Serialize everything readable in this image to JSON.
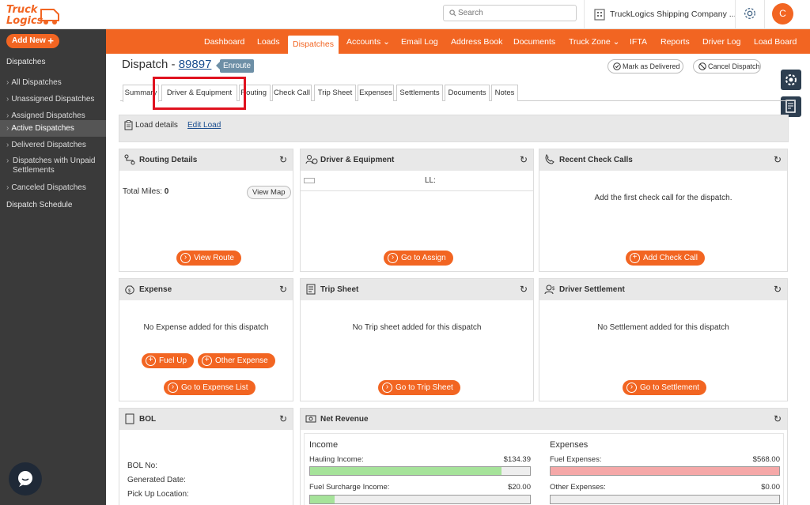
{
  "header": {
    "logo_text_line1": "Truck",
    "logo_text_line2": "Logics",
    "search_placeholder": "Search",
    "company_name": "TruckLogics Shipping Company ...",
    "avatar_initial": "C"
  },
  "sidebar": {
    "add_new": "Add New",
    "section": "Dispatches",
    "items": [
      {
        "label": "All Dispatches"
      },
      {
        "label": "Unassigned Dispatches"
      },
      {
        "label": "Assigned Dispatches"
      },
      {
        "label": "Active Dispatches"
      },
      {
        "label": "Delivered Dispatches"
      },
      {
        "label": "Dispatches with Unpaid Settlements"
      },
      {
        "label": "Canceled Dispatches"
      }
    ],
    "schedule": "Dispatch Schedule"
  },
  "nav": {
    "items": [
      "Dashboard",
      "Loads",
      "Dispatches",
      "Accounts",
      "Email Log",
      "Address Book",
      "Documents",
      "Truck Zone",
      "IFTA",
      "Reports",
      "Driver Log",
      "Load Board"
    ]
  },
  "dispatch": {
    "title_prefix": "Dispatch - ",
    "number": "89897",
    "status": "Enroute",
    "mark_delivered": "Mark as Delivered",
    "cancel_dispatch": "Cancel Dispatch"
  },
  "tabs": [
    "Summary",
    "Driver & Equipment",
    "Routing",
    "Check Call",
    "Trip Sheet",
    "Expenses",
    "Settlements",
    "Documents",
    "Notes"
  ],
  "load_details": {
    "label": "Load details",
    "edit": "Edit Load"
  },
  "panels": {
    "routing": {
      "title": "Routing Details",
      "miles_label": "Total Miles:",
      "miles_value": "0",
      "view_map": "View Map",
      "button": "View Route"
    },
    "driver": {
      "title": "Driver & Equipment",
      "ll": "LL:",
      "button": "Go to Assign"
    },
    "checkcalls": {
      "title": "Recent Check Calls",
      "message": "Add the first check call for the dispatch.",
      "button": "Add Check Call"
    },
    "expense": {
      "title": "Expense",
      "message": "No Expense added for this dispatch",
      "fuel": "Fuel Up",
      "other": "Other Expense",
      "list": "Go to Expense List"
    },
    "tripsheet": {
      "title": "Trip Sheet",
      "message": "No Trip sheet added for this dispatch",
      "button": "Go to Trip Sheet"
    },
    "settlement": {
      "title": "Driver Settlement",
      "message": "No Settlement added for this dispatch",
      "button": "Go to Settlement"
    },
    "bol": {
      "title": "BOL",
      "lines": [
        "BOL No:",
        "Generated Date:",
        "Pick Up Location:"
      ]
    },
    "revenue": {
      "title": "Net Revenue",
      "income_title": "Income",
      "expenses_title": "Expenses",
      "income": [
        {
          "label": "Hauling Income:",
          "value": "$134.39",
          "fraction": 0.87
        },
        {
          "label": "Fuel Surcharge Income:",
          "value": "$20.00",
          "fraction": 0.11
        }
      ],
      "expenses": [
        {
          "label": "Fuel Expenses:",
          "value": "$568.00",
          "fraction": 1.0
        },
        {
          "label": "Other Expenses:",
          "value": "$0.00",
          "fraction": 0
        }
      ]
    }
  },
  "colors": {
    "brand": "#f26522",
    "sidebar": "#3a3a3a",
    "income_fill": "#a6e39a",
    "expense_fill": "#f5a8a8",
    "highlight": "#e0121f"
  }
}
